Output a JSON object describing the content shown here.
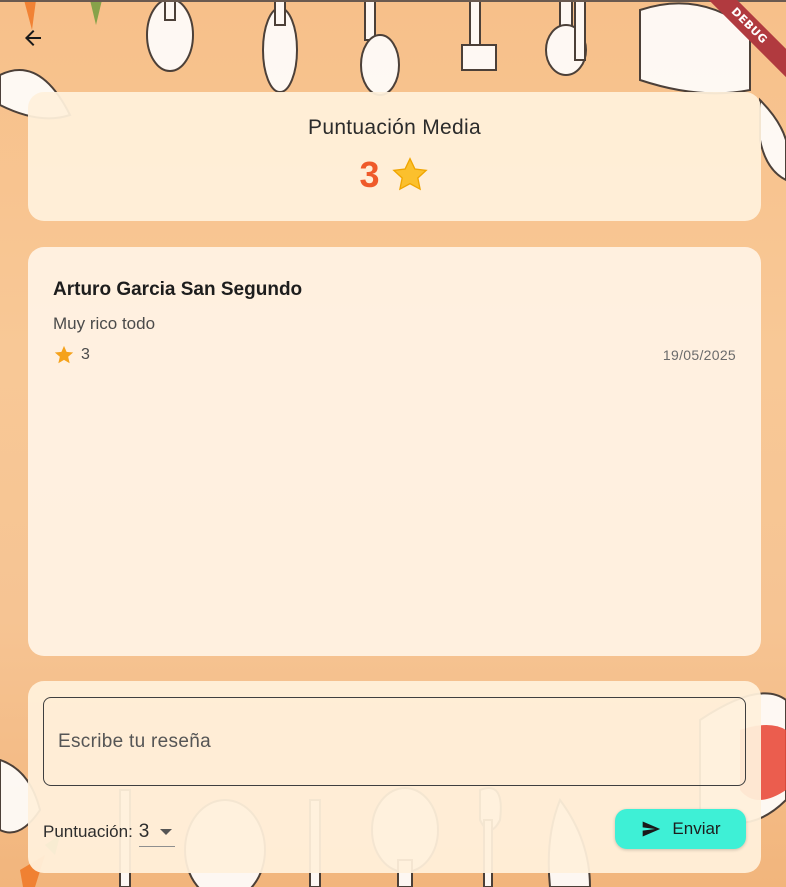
{
  "debug_banner": "DEBUG",
  "average_card": {
    "title": "Puntuación Media",
    "value": "3",
    "star_icon": "star-emoji-icon"
  },
  "reviews": [
    {
      "name": "Arturo Garcia San Segundo",
      "text": "Muy rico todo",
      "rating": "3",
      "date": "19/05/2025"
    }
  ],
  "form": {
    "review_placeholder": "Escribe tu reseña",
    "score_label": "Puntuación:",
    "score_value": "3",
    "send_label": "Enviar"
  },
  "colors": {
    "accent_orange": "#ef5a2a",
    "send_button": "#3ef0d6",
    "card_bg": "#fff0db",
    "star": "#f5a21b"
  }
}
